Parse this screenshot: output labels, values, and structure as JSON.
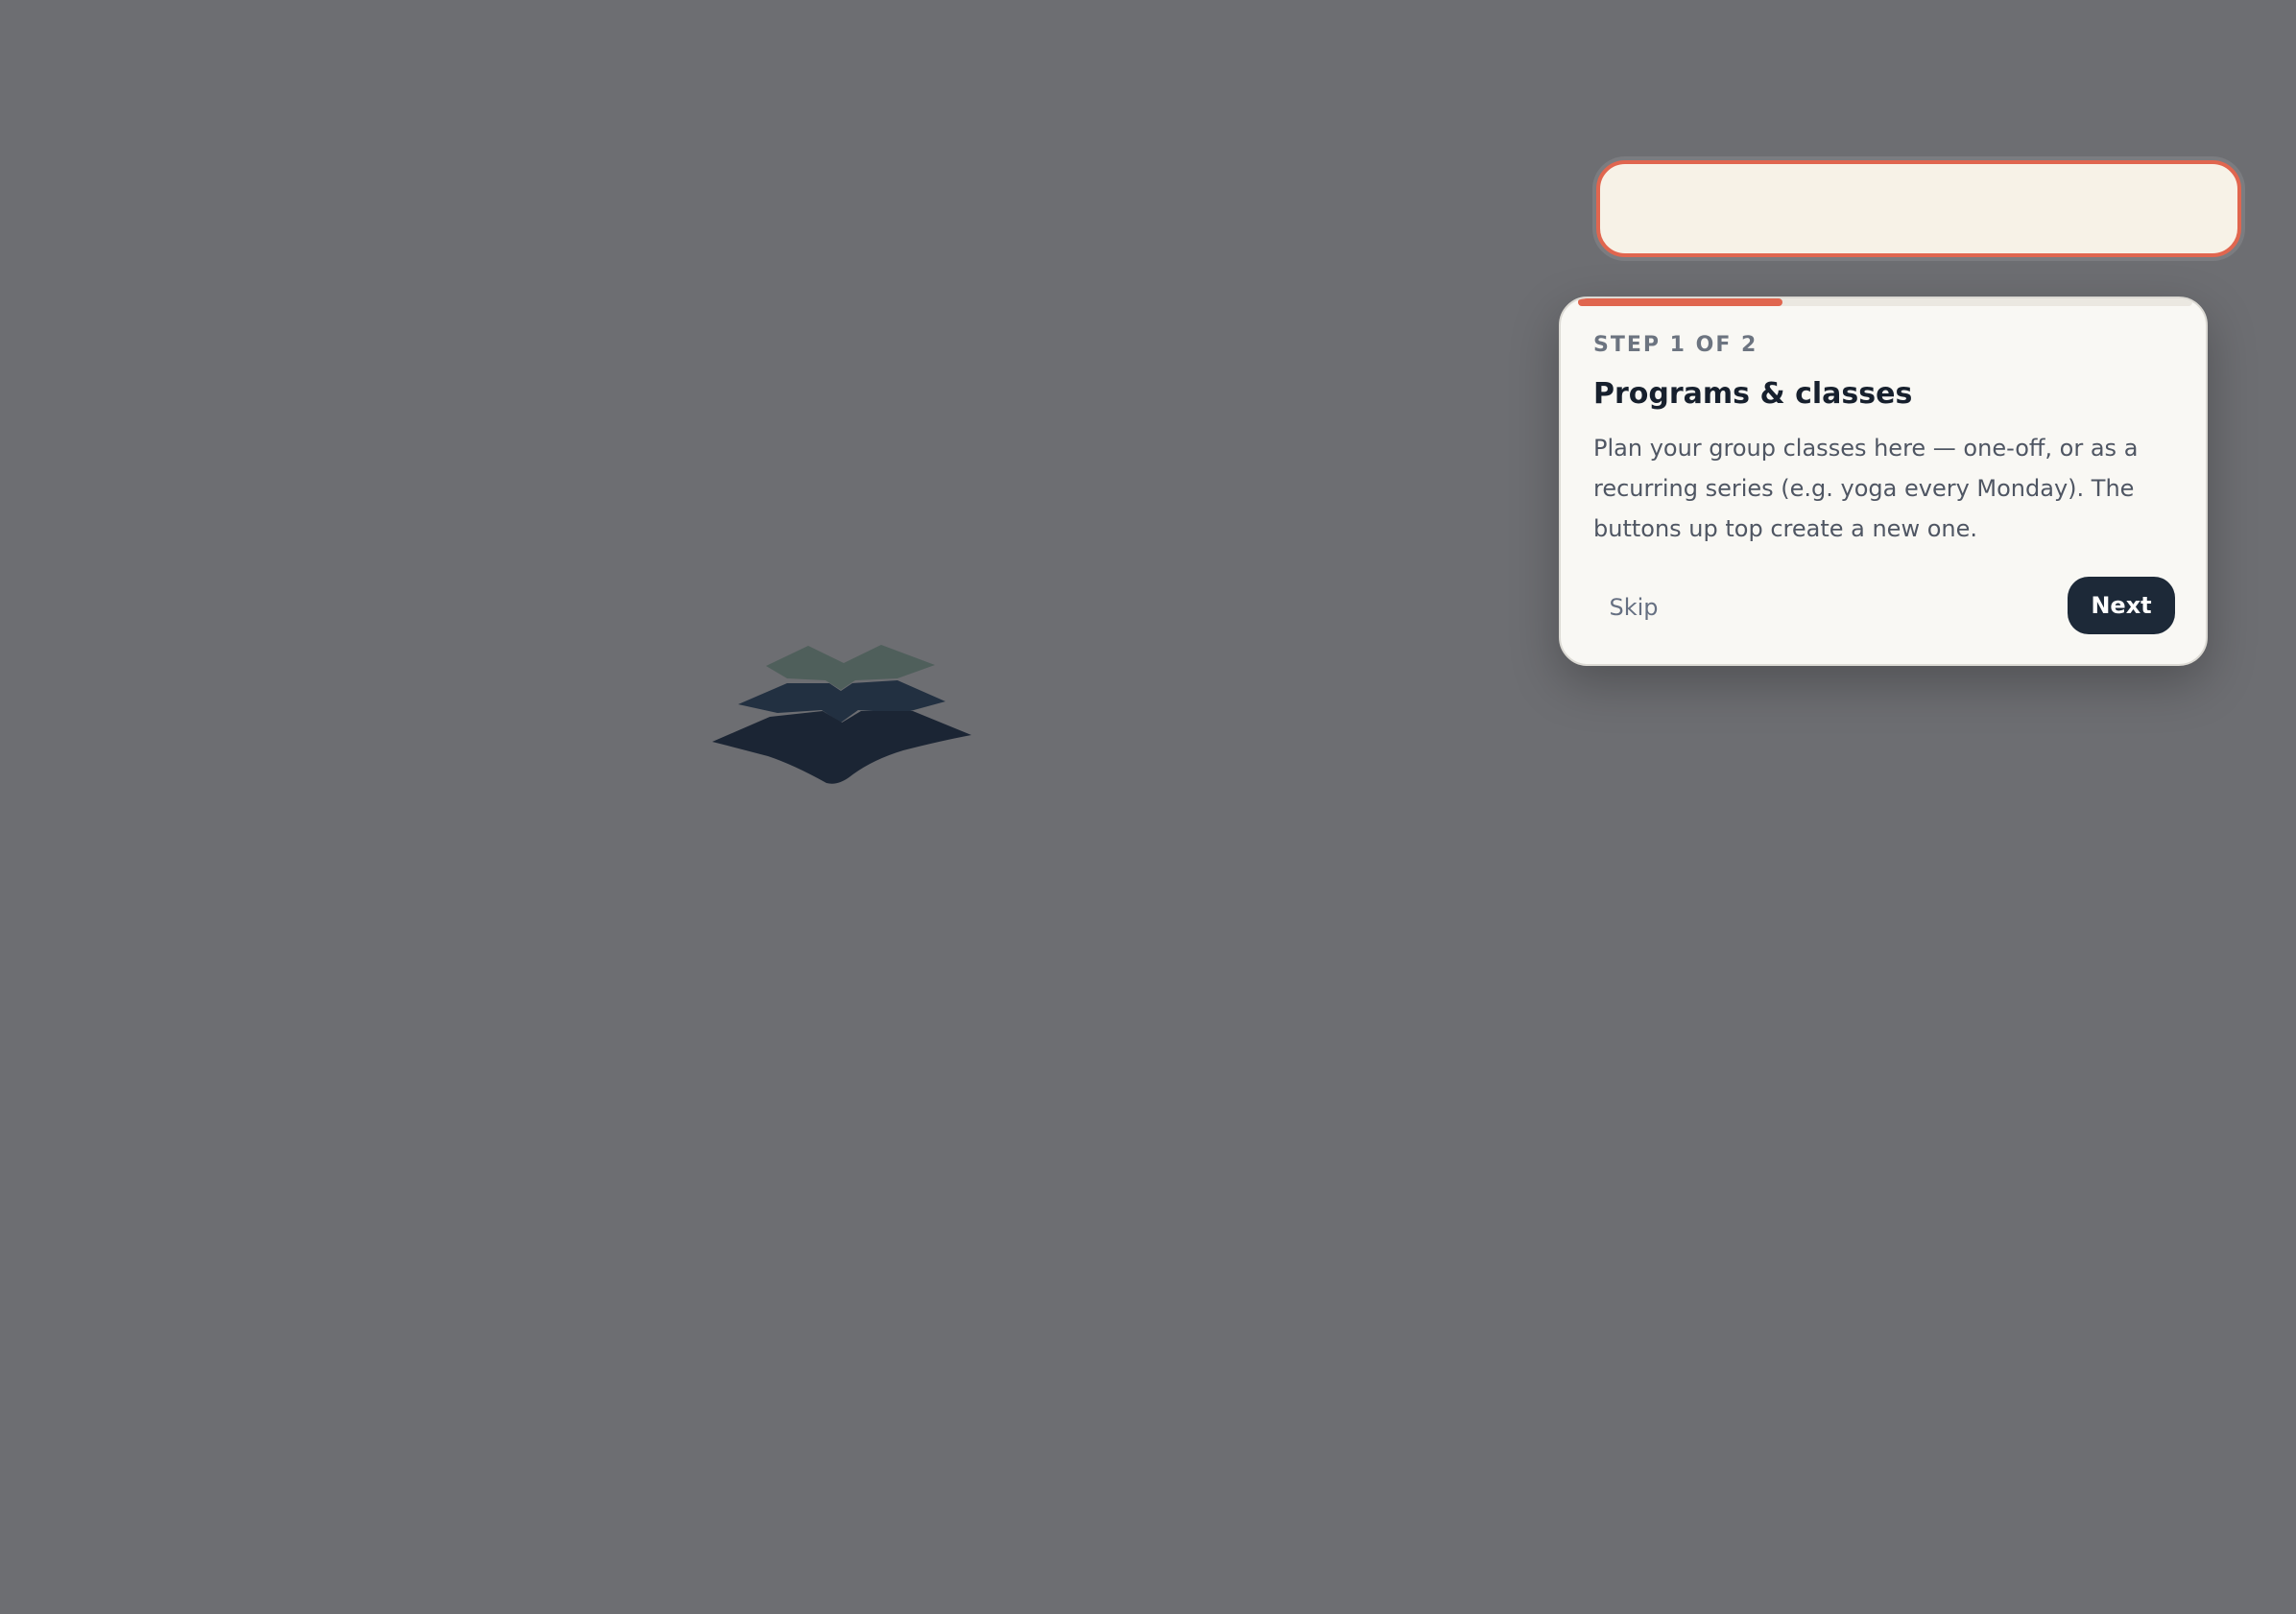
{
  "tour": {
    "step_label": "STEP 1 OF 2",
    "progress_fraction": 0.333,
    "title": "Programs & classes",
    "body": "Plan your group classes here — one-off, or as a recurring series (e.g. yoga every Monday). The buttons up top create a new one.",
    "skip_label": "Skip",
    "next_label": "Next"
  },
  "colors": {
    "overlay": "#6d6e72",
    "accent": "#e0664f",
    "card_bg": "#f9f8f4",
    "spotlight_bg": "#f7f2e7",
    "button_dark": "#1d2938",
    "logo_dark": "#1b2534",
    "logo_mid": "#223041",
    "logo_green": "#4f5f5b"
  },
  "icons": {
    "logo": "stacked-layers-logo"
  }
}
